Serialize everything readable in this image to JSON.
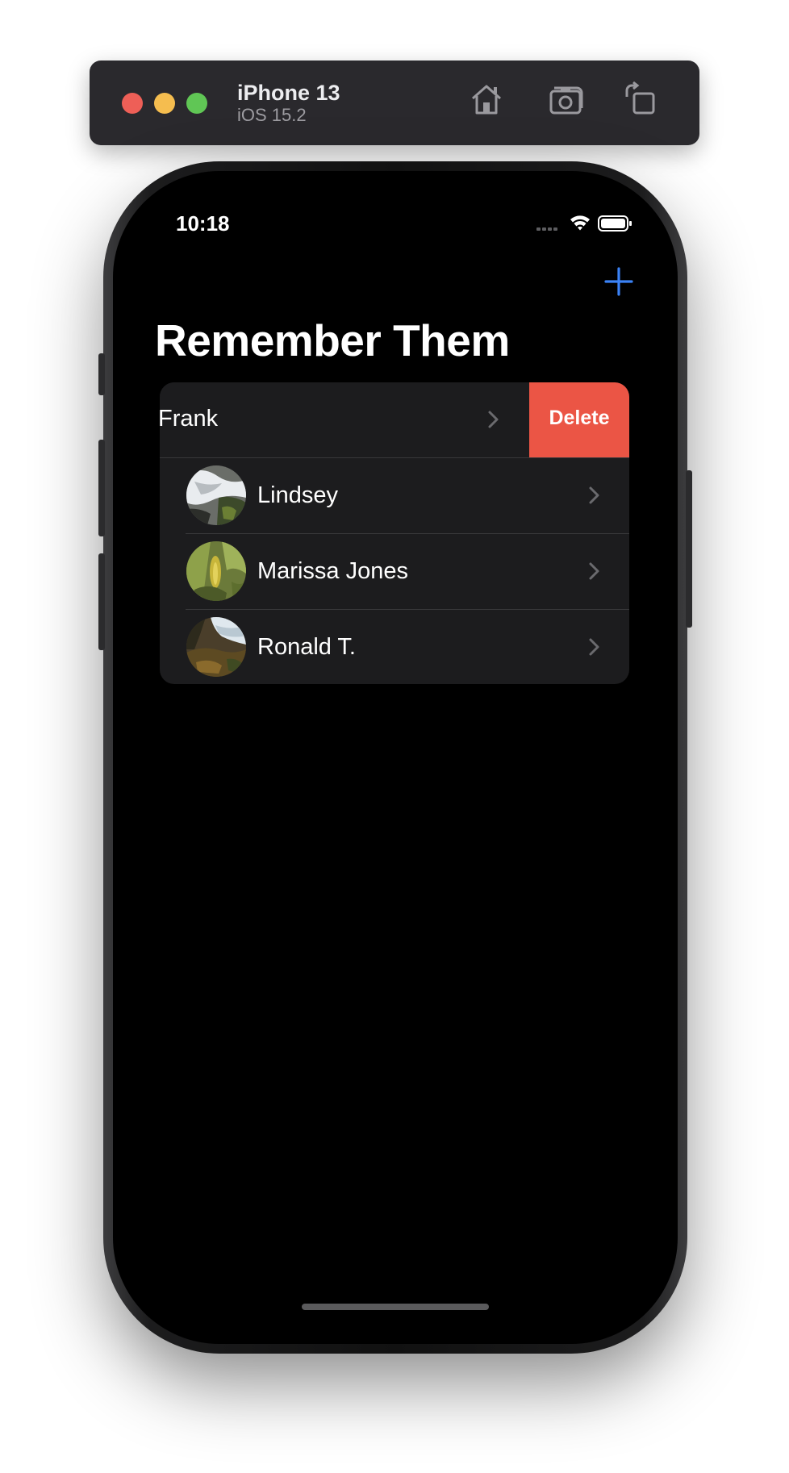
{
  "simulator": {
    "device_name": "iPhone 13",
    "os_version": "iOS 15.2",
    "toolbar_icons": [
      "home-icon",
      "screenshot-icon",
      "rotate-icon"
    ]
  },
  "status_bar": {
    "time": "10:18",
    "icons": [
      "cellular-icon",
      "wifi-icon",
      "battery-icon"
    ]
  },
  "nav": {
    "title": "Remember Them",
    "add_icon": "plus-icon"
  },
  "people": [
    {
      "name": "Frank",
      "swiped": true
    },
    {
      "name": "Lindsey",
      "swiped": false
    },
    {
      "name": "Marissa Jones",
      "swiped": false
    },
    {
      "name": "Ronald T.",
      "swiped": false
    }
  ],
  "swipe_action": {
    "label": "Delete"
  },
  "colors": {
    "accent": "#3b82f6",
    "delete": "#eb5545",
    "cell_background": "#1c1c1e",
    "screen_background": "#000000"
  }
}
